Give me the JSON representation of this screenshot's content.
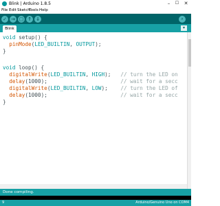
{
  "window": {
    "title": "Blink | Arduino 1.8.5",
    "minimize_glyph": "–",
    "maximize_glyph": "☐",
    "close_glyph": "✕"
  },
  "menu": [
    "File",
    "Edit",
    "Sketch",
    "Tools",
    "Help"
  ],
  "toolbar": {
    "verify_icon": "✓",
    "upload_icon": "→",
    "new_icon": "▢",
    "open_icon": "↑",
    "save_icon": "↓",
    "serial_icon": "⌕"
  },
  "tabs": {
    "active": "Blink",
    "menu_glyph": "▾"
  },
  "code": {
    "l1": {
      "kw": "void",
      "t1": " setup() {"
    },
    "l2": {
      "indent": "  ",
      "fn": "pinMode",
      "t1": "(",
      "c1": "LED_BUILTIN",
      "t2": ", ",
      "c2": "OUTPUT",
      "t3": ");"
    },
    "l3": {
      "t1": "}"
    },
    "l5": {
      "kw": "void",
      "t1": " loop() {"
    },
    "l6": {
      "indent": "  ",
      "fn": "digitalWrite",
      "t1": "(",
      "c1": "LED_BUILTIN",
      "t2": ", ",
      "c2": "HIGH",
      "t3": ");   ",
      "cm": "// turn the LED on"
    },
    "l7": {
      "indent": "  ",
      "fn": "delay",
      "t1": "(1000);                       ",
      "cm": "// wait for a secc"
    },
    "l8": {
      "indent": "  ",
      "fn": "digitalWrite",
      "t1": "(",
      "c1": "LED_BUILTIN",
      "t2": ", ",
      "c2": "LOW",
      "t3": ");    ",
      "cm": "// turn the LED of"
    },
    "l9": {
      "indent": "  ",
      "fn": "delay",
      "t1": "(1000);                       ",
      "cm": "// wait for a secc"
    },
    "l10": {
      "t1": "}"
    }
  },
  "status": {
    "message": "Done compiling."
  },
  "footer": {
    "line_number": "9",
    "board": "Arduino/Genuino Uno on COM4"
  },
  "colors": {
    "toolbar": "#006468",
    "accent": "#17a1a5",
    "keyword": "#00979c",
    "function": "#d35400",
    "comment": "#95a5a6"
  }
}
